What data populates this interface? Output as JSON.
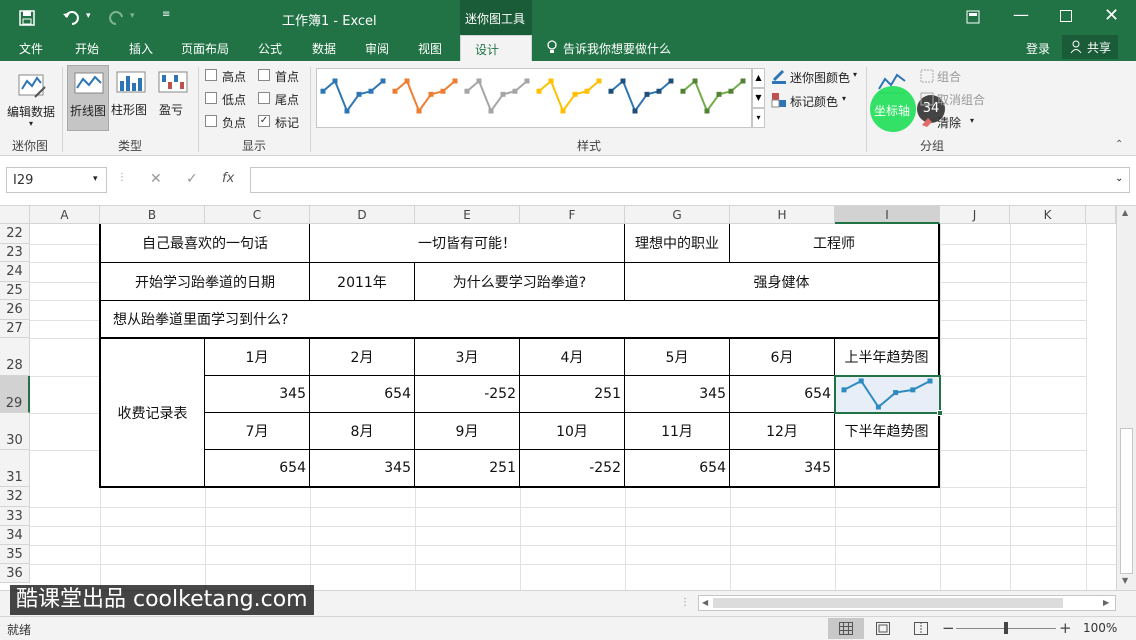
{
  "window": {
    "title": "工作簿1 - Excel",
    "context_tab": "迷你图工具"
  },
  "tabs": [
    {
      "label": "文件"
    },
    {
      "label": "开始"
    },
    {
      "label": "插入"
    },
    {
      "label": "页面布局"
    },
    {
      "label": "公式"
    },
    {
      "label": "数据"
    },
    {
      "label": "审阅"
    },
    {
      "label": "视图"
    },
    {
      "label": "设计"
    }
  ],
  "tell_me": "告诉我你想要做什么",
  "login": "登录",
  "share": "共享",
  "ribbon": {
    "sparkline_group": {
      "edit_data": "编辑数据",
      "label": "迷你图"
    },
    "type_group": {
      "line": "折线图",
      "column": "柱形图",
      "winloss": "盈亏",
      "label": "类型"
    },
    "show_group": {
      "high": "高点",
      "first": "首点",
      "low": "低点",
      "last": "尾点",
      "negative": "负点",
      "markers": "标记",
      "label": "显示"
    },
    "style_group": {
      "label": "样式",
      "sparkline_color": "迷你图颜色",
      "marker_color": "标记颜色"
    },
    "group_group": {
      "axis": "坐标轴",
      "group": "组合",
      "ungroup": "取消组合",
      "clear": "清除",
      "label": "分组",
      "badge": "34"
    }
  },
  "formula_bar": {
    "name_box": "I29",
    "fx": "fx",
    "content": ""
  },
  "columns": [
    "A",
    "B",
    "C",
    "D",
    "E",
    "F",
    "G",
    "H",
    "I",
    "J",
    "K"
  ],
  "rows": [
    "22",
    "23",
    "24",
    "25",
    "26",
    "27",
    "28",
    "29",
    "30",
    "31",
    "32",
    "33",
    "34",
    "35",
    "36"
  ],
  "sheet": {
    "favorite_quote_label": "自己最喜欢的一句话",
    "favorite_quote": "一切皆有可能！",
    "ideal_job_label": "理想中的职业",
    "ideal_job": "工程师",
    "start_date_label": "开始学习跆拳道的日期",
    "start_date": "2011年",
    "why_label": "为什么要学习跆拳道?",
    "why": "强身健体",
    "what_label": "想从跆拳道里面学习到什么?",
    "fee_label": "收费记录表",
    "months_h1": [
      "1月",
      "2月",
      "3月",
      "4月",
      "5月",
      "6月"
    ],
    "values_h1": [
      "345",
      "654",
      "-252",
      "251",
      "345",
      "654"
    ],
    "months_h2": [
      "7月",
      "8月",
      "9月",
      "10月",
      "11月",
      "12月"
    ],
    "values_h2": [
      "654",
      "345",
      "251",
      "-252",
      "654",
      "345"
    ],
    "h1_trend_label": "上半年趋势图",
    "h2_trend_label": "下半年趋势图"
  },
  "sparkline": {
    "values": [
      345,
      654,
      -252,
      251,
      345,
      654
    ],
    "color": "#2e8bc0"
  },
  "status": {
    "ready": "就绪",
    "zoom": "100%"
  },
  "watermark": "酷课堂出品 coolketang.com",
  "colors": {
    "excel_green": "#217346",
    "highlight": "#22e05a"
  }
}
